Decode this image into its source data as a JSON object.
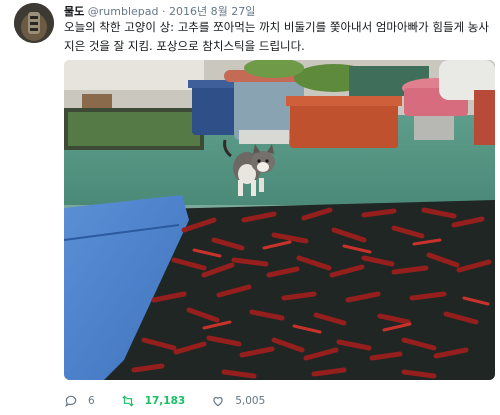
{
  "tweet": {
    "display_name": "물도",
    "handle": "@rumblepad",
    "separator": "·",
    "date": "2016년 8월 27일",
    "text": "오늘의 착한 고양이 상: 고추를 쪼아먹는 까치 비둘기를 쫓아내서 엄마아빠가 힘들게 농사지은 것을 잘 지킴. 포상으로 참치스틱을 드립니다."
  },
  "actions": {
    "replies": "6",
    "retweets": "17,183",
    "likes": "5,005"
  },
  "icons": {
    "reply": "reply-icon",
    "retweet": "retweet-icon",
    "like": "heart-icon"
  },
  "colors": {
    "retweet_active": "#17bf63",
    "muted": "#657786"
  }
}
